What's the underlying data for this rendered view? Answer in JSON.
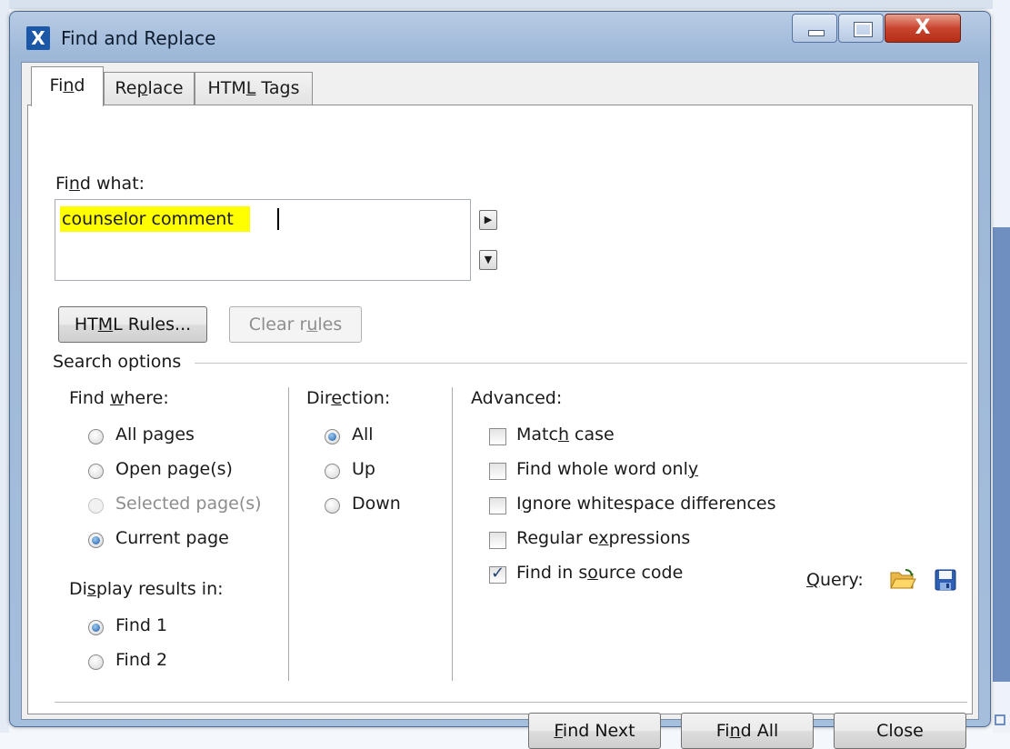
{
  "window": {
    "title": "Find and Replace",
    "close_glyph": "X",
    "app_icon": "X"
  },
  "tabs": [
    {
      "label_pre": "Fi",
      "label_u": "n",
      "label_post": "d",
      "active": true
    },
    {
      "label_pre": "Re",
      "label_u": "p",
      "label_post": "lace",
      "active": false
    },
    {
      "label_pre": "HTM",
      "label_u": "L",
      "label_post": " Tags",
      "active": false
    }
  ],
  "find": {
    "label_pre": "Fi",
    "label_u": "n",
    "label_post": "d what:",
    "value": "counselor comment",
    "highlight_color": "#ffff00"
  },
  "buttons": {
    "html_rules_pre": "HT",
    "html_rules_u": "M",
    "html_rules_post": "L Rules...",
    "clear_rules_pre": "Clear r",
    "clear_rules_u": "u",
    "clear_rules_post": "les"
  },
  "search_options": {
    "label": "Search options",
    "find_where": {
      "label_pre": "Find ",
      "label_u": "w",
      "label_post": "here:",
      "options": [
        {
          "label": "All pages",
          "selected": false,
          "enabled": true
        },
        {
          "label": "Open page(s)",
          "selected": false,
          "enabled": true
        },
        {
          "label": "Selected page(s)",
          "selected": false,
          "enabled": false
        },
        {
          "label": "Current page",
          "selected": true,
          "enabled": true
        }
      ]
    },
    "display_results": {
      "label_pre": "Di",
      "label_u": "s",
      "label_post": "play results in:",
      "options": [
        {
          "label": "Find 1",
          "selected": true
        },
        {
          "label": "Find 2",
          "selected": false
        }
      ]
    },
    "direction": {
      "label_pre": "Dir",
      "label_u": "e",
      "label_post": "ction:",
      "options": [
        {
          "label": "All",
          "selected": true
        },
        {
          "label": "Up",
          "selected": false
        },
        {
          "label": "Down",
          "selected": false
        }
      ]
    },
    "advanced": {
      "label": "Advanced:",
      "options": [
        {
          "pre": "Matc",
          "u": "h",
          "post": " case",
          "checked": false
        },
        {
          "pre": "Find whole word onl",
          "u": "y",
          "post": "",
          "checked": false
        },
        {
          "pre": "I",
          "u": "g",
          "post": "nore whitespace differences",
          "checked": false
        },
        {
          "pre": "Regular e",
          "u": "x",
          "post": "pressions",
          "checked": false
        },
        {
          "pre": "Find in s",
          "u": "o",
          "post": "urce code",
          "checked": true
        }
      ],
      "query_label_u": "Q",
      "query_label_post": "uery:",
      "query_open_icon": "folder-open-icon",
      "query_save_icon": "save-icon"
    }
  },
  "footer": {
    "find_next_u": "F",
    "find_next_post": "ind Next",
    "find_all_pre": "Fi",
    "find_all_u": "n",
    "find_all_post": "d All",
    "close": "Close"
  }
}
